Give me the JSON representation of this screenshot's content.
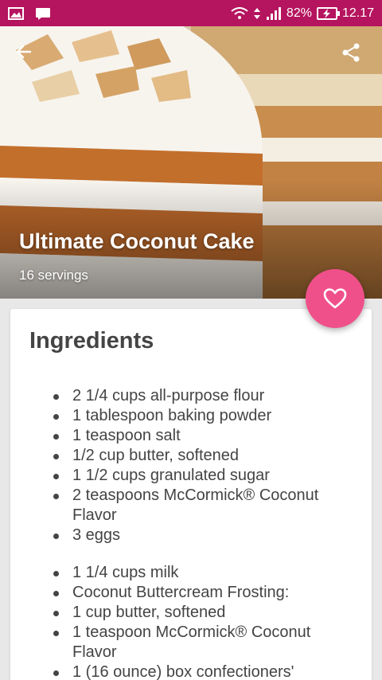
{
  "status_bar": {
    "battery": "82%",
    "time": "12.17"
  },
  "recipe": {
    "title": "Ultimate Coconut Cake",
    "servings": "16 servings"
  },
  "ingredients": {
    "heading": "Ingredients",
    "group1": [
      "2 1/4 cups all-purpose flour",
      "1 tablespoon baking powder",
      "1 teaspoon salt",
      "1/2 cup butter, softened",
      "1 1/2 cups granulated sugar",
      "2 teaspoons McCormick® Coconut Flavor",
      "3 eggs"
    ],
    "group2": [
      "1 1/4 cups milk",
      "Coconut Buttercream Frosting:",
      "1 cup butter, softened",
      "1 teaspoon McCormick® Coconut Flavor",
      "1 (16 ounce) box confectioners'"
    ]
  },
  "colors": {
    "status_bar": "#b5145e",
    "fab": "#f0508a",
    "text": "#444444"
  },
  "icons": {
    "back": "arrow-left-icon",
    "share": "share-icon",
    "favorite": "heart-outline-icon"
  }
}
